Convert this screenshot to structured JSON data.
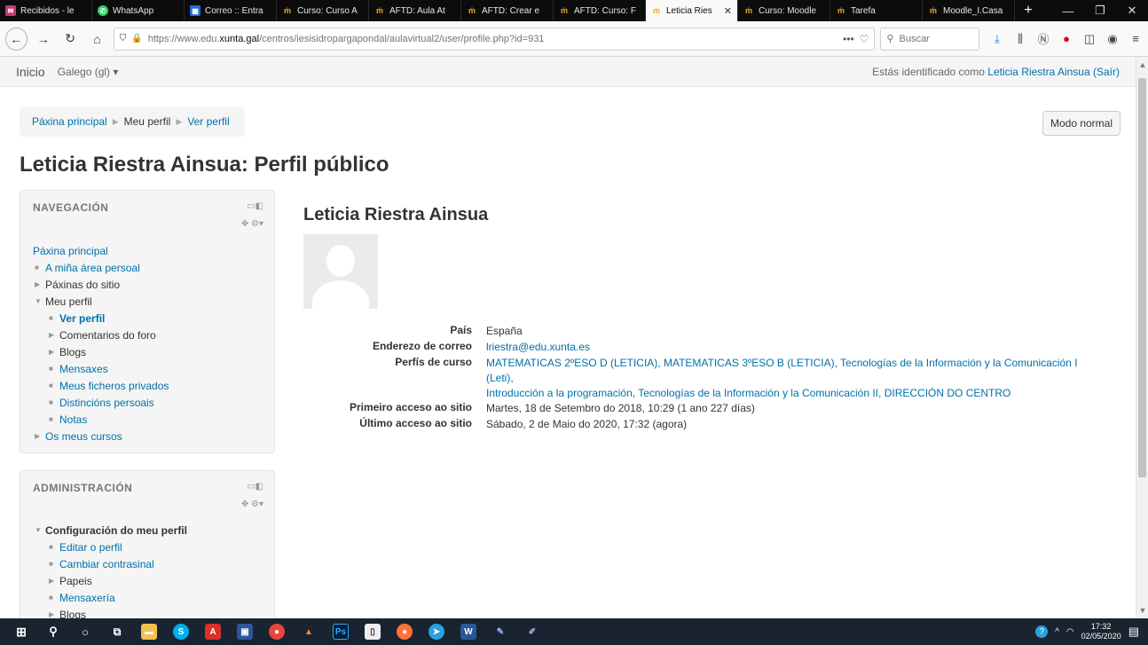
{
  "browser": {
    "tabs": [
      {
        "label": "Recibidos - le",
        "icon": "mail-icon"
      },
      {
        "label": "WhatsApp",
        "icon": "whatsapp-icon"
      },
      {
        "label": "Correo :: Entra",
        "icon": "outlook-icon"
      },
      {
        "label": "Curso: Curso A",
        "icon": "moodle-icon"
      },
      {
        "label": "AFTD: Aula At",
        "icon": "moodle-icon"
      },
      {
        "label": "AFTD: Crear e",
        "icon": "moodle-icon"
      },
      {
        "label": "AFTD: Curso: F",
        "icon": "moodle-icon"
      },
      {
        "label": "Leticia Ries",
        "icon": "moodle-icon",
        "active": true
      },
      {
        "label": "Curso: Moodle",
        "icon": "moodle-icon"
      },
      {
        "label": "Tarefa",
        "icon": "moodle-icon"
      },
      {
        "label": "Moodle_I.Casa",
        "icon": "moodle-icon"
      }
    ],
    "url_prefix": "https://www.edu.",
    "url_domain": "xunta.gal",
    "url_path": "/centros/iesisidropargapondal/aulavirtual2/user/profile.php?id=931",
    "search_placeholder": "Buscar"
  },
  "topbar": {
    "home": "Inicio",
    "language": "Galego (gl) ▾",
    "logged_prefix": "Estás identificado como ",
    "user_name": "Leticia Riestra Ainsua",
    "logout": "(Saír)"
  },
  "breadcrumb": {
    "items": [
      "Páxina principal",
      "Meu perfil",
      "Ver perfil"
    ]
  },
  "mode_button": "Modo normal",
  "page_title": "Leticia Riestra Ainsua: Perfil público",
  "navigation": {
    "heading": "NAVEGACIÓN",
    "root": "Páxina principal",
    "items": [
      "A miña área persoal",
      "Páxinas do sitio",
      "Meu perfil",
      "Ver perfil",
      "Comentarios do foro",
      "Blogs",
      "Mensaxes",
      "Meus ficheros privados",
      "Distincións persoais",
      "Notas",
      "Os meus cursos"
    ]
  },
  "administration": {
    "heading": "ADMINISTRACIÓN",
    "items": [
      "Configuración do meu perfil",
      "Editar o perfil",
      "Cambiar contrasinal",
      "Papeis",
      "Mensaxería",
      "Blogs"
    ]
  },
  "profile": {
    "name": "Leticia Riestra Ainsua",
    "fields": {
      "country_label": "País",
      "country": "España",
      "email_label": "Enderezo de correo",
      "email": "lriestra@edu.xunta.es",
      "courses_label": "Perfís de curso",
      "courses_line1": "MATEMATICAS 2ºESO D (LETICIA), MATEMATICAS 3ºESO B (LETICIA), Tecnologías de la Información y la Comunicación I (Leti),",
      "courses_line2": "Introducción a la programación, Tecnologías de la Información y la Comunicación II, DIRECCIÓN DO CENTRO",
      "first_access_label": "Primeiro acceso ao sitio",
      "first_access": "Martes, 18 de Setembro do 2018, 10:29  (1 ano 227 días)",
      "last_access_label": "Último acceso ao sitio",
      "last_access": "Sábado, 2 de Maio do 2020, 17:32  (agora)"
    }
  },
  "taskbar": {
    "time": "17:32",
    "date": "02/05/2020"
  }
}
